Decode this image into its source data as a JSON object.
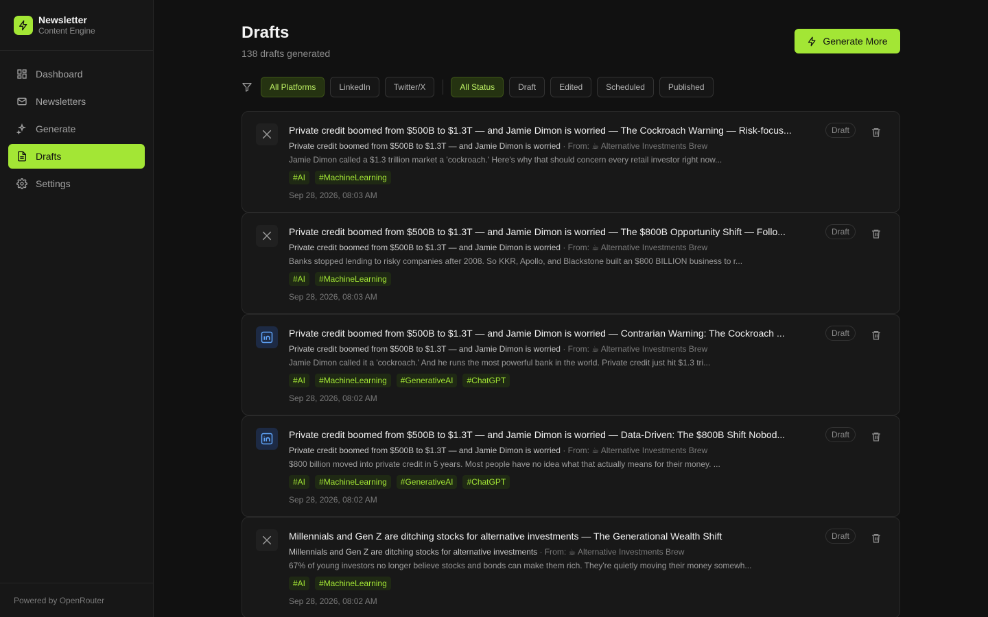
{
  "brand": {
    "name": "Newsletter",
    "subtitle": "Content Engine",
    "accent": "#a3e635"
  },
  "nav": [
    {
      "label": "Dashboard",
      "icon": "dashboard-icon"
    },
    {
      "label": "Newsletters",
      "icon": "mail-icon"
    },
    {
      "label": "Generate",
      "icon": "sparkles-icon"
    },
    {
      "label": "Drafts",
      "icon": "document-icon",
      "active": true
    },
    {
      "label": "Settings",
      "icon": "gear-icon"
    }
  ],
  "footer": "Powered by OpenRouter",
  "page": {
    "title": "Drafts",
    "subtitle": "138 drafts generated",
    "generate_label": "Generate More"
  },
  "filters": {
    "platforms": [
      "All Platforms",
      "LinkedIn",
      "Twitter/X"
    ],
    "statuses": [
      "All Status",
      "Draft",
      "Edited",
      "Scheduled",
      "Published"
    ]
  },
  "drafts": [
    {
      "platform": "x",
      "title": "Private credit boomed from $500B to $1.3T — and Jamie Dimon is worried — The Cockroach Warning — Risk-focus...",
      "source_title": "Private credit boomed from $500B to $1.3T — and Jamie Dimon is worried",
      "from_label": "· From:",
      "source": "☕ Alternative Investments Brew",
      "preview": "Jamie Dimon called a $1.3 trillion market a 'cockroach.' Here's why that should concern every retail investor right now...",
      "tags": [
        "#AI",
        "#MachineLearning"
      ],
      "date": "Sep 28, 2026, 08:03 AM",
      "status": "Draft"
    },
    {
      "platform": "x",
      "title": "Private credit boomed from $500B to $1.3T — and Jamie Dimon is worried — The $800B Opportunity Shift — Follo...",
      "source_title": "Private credit boomed from $500B to $1.3T — and Jamie Dimon is worried",
      "from_label": "· From:",
      "source": "☕ Alternative Investments Brew",
      "preview": "Banks stopped lending to risky companies after 2008. So KKR, Apollo, and Blackstone built an $800 BILLION business to r...",
      "tags": [
        "#AI",
        "#MachineLearning"
      ],
      "date": "Sep 28, 2026, 08:03 AM",
      "status": "Draft"
    },
    {
      "platform": "linkedin",
      "title": "Private credit boomed from $500B to $1.3T — and Jamie Dimon is worried — Contrarian Warning: The Cockroach ...",
      "source_title": "Private credit boomed from $500B to $1.3T — and Jamie Dimon is worried",
      "from_label": "· From:",
      "source": "☕ Alternative Investments Brew",
      "preview": "Jamie Dimon called it a 'cockroach.' And he runs the most powerful bank in the world. Private credit just hit $1.3 tri...",
      "tags": [
        "#AI",
        "#MachineLearning",
        "#GenerativeAI",
        "#ChatGPT"
      ],
      "date": "Sep 28, 2026, 08:02 AM",
      "status": "Draft"
    },
    {
      "platform": "linkedin",
      "title": "Private credit boomed from $500B to $1.3T — and Jamie Dimon is worried — Data-Driven: The $800B Shift Nobod...",
      "source_title": "Private credit boomed from $500B to $1.3T — and Jamie Dimon is worried",
      "from_label": "· From:",
      "source": "☕ Alternative Investments Brew",
      "preview": "$800 billion moved into private credit in 5 years. Most people have no idea what that actually means for their money. ...",
      "tags": [
        "#AI",
        "#MachineLearning",
        "#GenerativeAI",
        "#ChatGPT"
      ],
      "date": "Sep 28, 2026, 08:02 AM",
      "status": "Draft"
    },
    {
      "platform": "x",
      "title": "Millennials and Gen Z are ditching stocks for alternative investments — The Generational Wealth Shift",
      "source_title": "Millennials and Gen Z are ditching stocks for alternative investments",
      "from_label": "· From:",
      "source": "☕ Alternative Investments Brew",
      "preview": "67% of young investors no longer believe stocks and bonds can make them rich. They're quietly moving their money somewh...",
      "tags": [
        "#AI",
        "#MachineLearning"
      ],
      "date": "Sep 28, 2026, 08:02 AM",
      "status": "Draft"
    }
  ]
}
